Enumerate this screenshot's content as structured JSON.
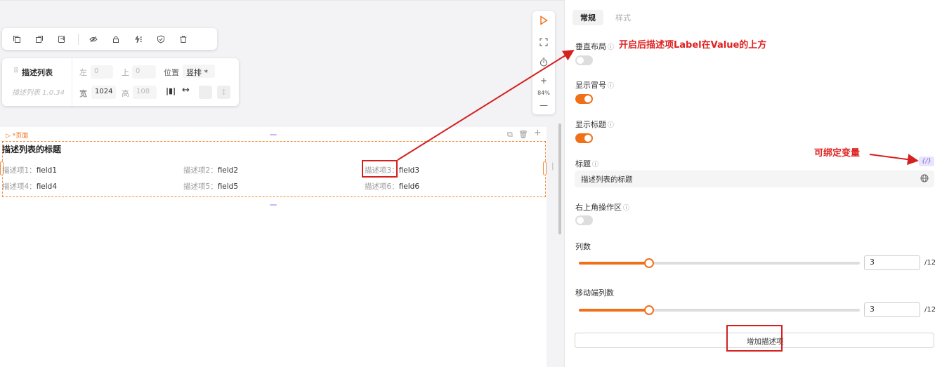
{
  "toolbar": {
    "items": [
      "copy-icon",
      "duplicate-icon",
      "paste-icon",
      "eye-off-icon",
      "lock-icon",
      "event-icon",
      "shield-icon",
      "delete-icon"
    ]
  },
  "component": {
    "name": "描述列表",
    "version": "描述列表 1.0.34",
    "left_label": "左",
    "left_value": "0",
    "top_label": "上",
    "top_value": "0",
    "position_label": "位置",
    "position_value": "竖排 *",
    "width_label": "宽",
    "width_value": "1024",
    "height_label": "高",
    "height_value": "108"
  },
  "canvas": {
    "page_label": "▷ *页面",
    "desc_title": "描述列表的标题",
    "items": [
      {
        "label": "描述项1：",
        "value": "field1"
      },
      {
        "label": "描述项2：",
        "value": "field2"
      },
      {
        "label": "描述项3：",
        "value": "field3"
      },
      {
        "label": "描述项4：",
        "value": "field4"
      },
      {
        "label": "描述项5：",
        "value": "field5"
      },
      {
        "label": "描述项6：",
        "value": "field6"
      }
    ],
    "zoom": "84%"
  },
  "panel": {
    "tabs": [
      {
        "label": "常规"
      },
      {
        "label": "样式"
      }
    ],
    "vertical_layout": {
      "label": "垂直布局",
      "on": false
    },
    "show_colon": {
      "label": "显示冒号",
      "on": true
    },
    "show_title": {
      "label": "显示标题",
      "on": true
    },
    "title": {
      "label": "标题",
      "value": "描述列表的标题",
      "var_badge": "{/}"
    },
    "top_right_actions": {
      "label": "右上角操作区",
      "on": false
    },
    "columns": {
      "label": "列数",
      "value": "3",
      "suffix": "/12",
      "level": 0.25
    },
    "mobile_columns": {
      "label": "移动端列数",
      "value": "3",
      "suffix": "/12",
      "level": 0.25
    },
    "add_button": "增加描述项"
  },
  "annotations": {
    "vertical_note": "开启后描述项Label在Value的上方",
    "variable_note": "可绑定变量"
  },
  "colors": {
    "accent": "#f07018",
    "annotation": "#e02020"
  }
}
